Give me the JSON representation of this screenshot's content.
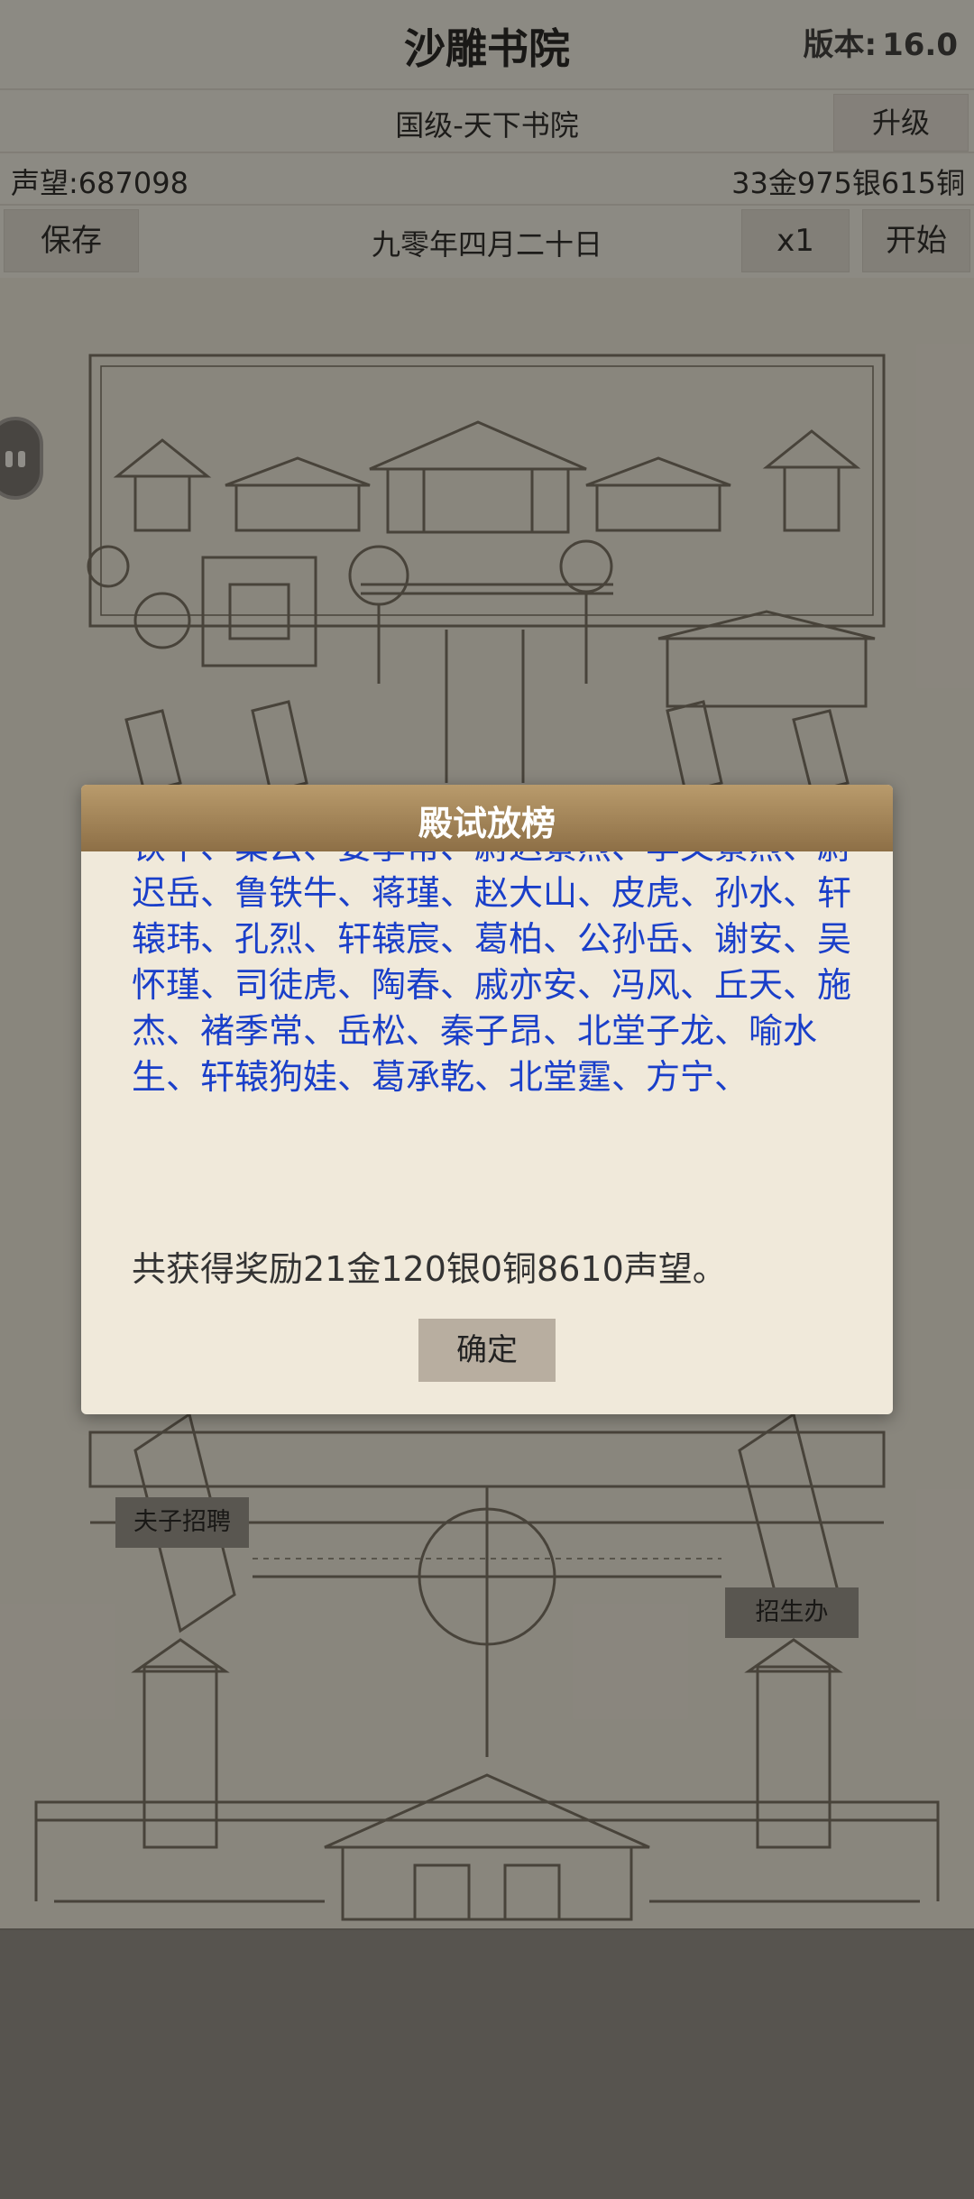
{
  "header": {
    "title": "沙雕书院",
    "version_label": "版本:",
    "version_value": "16.0"
  },
  "level": {
    "text": "国级-天下书院",
    "upgrade_label": "升级"
  },
  "stats": {
    "fame": "声望:687098",
    "money": "33金975银615铜"
  },
  "controls": {
    "save_label": "保存",
    "date": "九零年四月二十日",
    "speed_label": "x1",
    "start_label": "开始"
  },
  "map": {
    "hire_label": "夫子招聘",
    "admit_label": "招生办"
  },
  "dialog": {
    "title": "殿试放榜",
    "names_text": "铁牛、粲云、姜季常、尉迟景烈、李文景烈、尉迟岳、鲁铁牛、蒋瑾、赵大山、皮虎、孙水、轩辕玮、孔烈、轩辕宸、葛柏、公孙岳、谢安、吴怀瑾、司徒虎、陶春、戚亦安、冯风、丘天、施杰、褚季常、岳松、秦子昂、北堂子龙、喻水生、轩辕狗娃、葛承乾、北堂霆、方宁、",
    "reward": "共获得奖励21金120银0铜8610声望。",
    "confirm_label": "确定"
  },
  "colors": {
    "names": "#1a3fc9",
    "header_top": "#b99b6c",
    "header_bottom": "#8d6f46"
  }
}
